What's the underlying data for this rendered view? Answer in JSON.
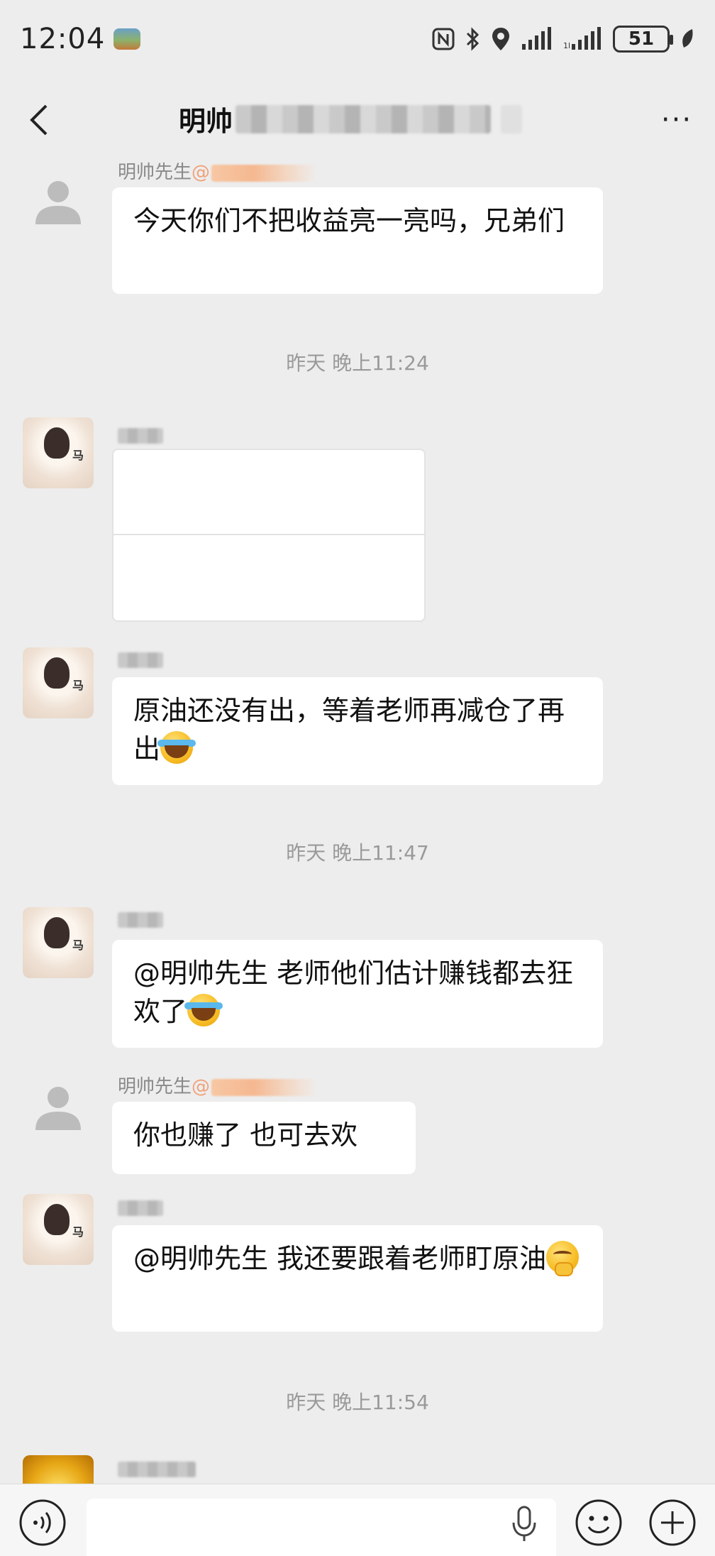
{
  "status_bar": {
    "time": "12:04",
    "battery": "51",
    "icons": [
      "nfc-icon",
      "bluetooth-icon",
      "location-icon",
      "signal-icon",
      "signal-icon-2",
      "battery-icon",
      "leaf-icon"
    ]
  },
  "header": {
    "title_visible": "明帅",
    "back_icon": "chevron-left-icon",
    "more_label": "···"
  },
  "messages": [
    {
      "type": "text",
      "sender": "明帅先生",
      "sender_suffix": "@",
      "avatar": "default",
      "text": "今天你们不把收益亮一亮吗，兄弟们"
    },
    {
      "type": "timestamp",
      "text": "昨天 晚上11:24"
    },
    {
      "type": "card",
      "sender": "",
      "avatar": "photo"
    },
    {
      "type": "text",
      "sender": "",
      "avatar": "photo",
      "text": "原油还没有出，等着老师再减仓了再出",
      "emoji": "crying"
    },
    {
      "type": "timestamp",
      "text": "昨天 晚上11:47"
    },
    {
      "type": "text",
      "sender": "",
      "avatar": "photo",
      "text": "@明帅先生  老师他们估计赚钱都去狂欢了",
      "emoji": "crying"
    },
    {
      "type": "text",
      "sender": "明帅先生",
      "sender_suffix": "@",
      "avatar": "default",
      "text": "你也赚了  也可去欢"
    },
    {
      "type": "text",
      "sender": "",
      "avatar": "photo",
      "text": "@明帅先生  我还要跟着老师盯原油",
      "emoji": "thinking"
    },
    {
      "type": "timestamp",
      "text": "昨天 晚上11:54"
    },
    {
      "type": "partial",
      "sender": "",
      "avatar": "gold"
    }
  ],
  "input_bar": {
    "voice_icon": "voice-icon",
    "mic_icon": "microphone-icon",
    "emoji_icon": "emoji-icon",
    "plus_icon": "plus-icon",
    "placeholder": ""
  },
  "colors": {
    "background": "#ededed",
    "bubble": "#ffffff",
    "timestamp": "#9a9a9a",
    "sender": "#8a8a8a"
  }
}
